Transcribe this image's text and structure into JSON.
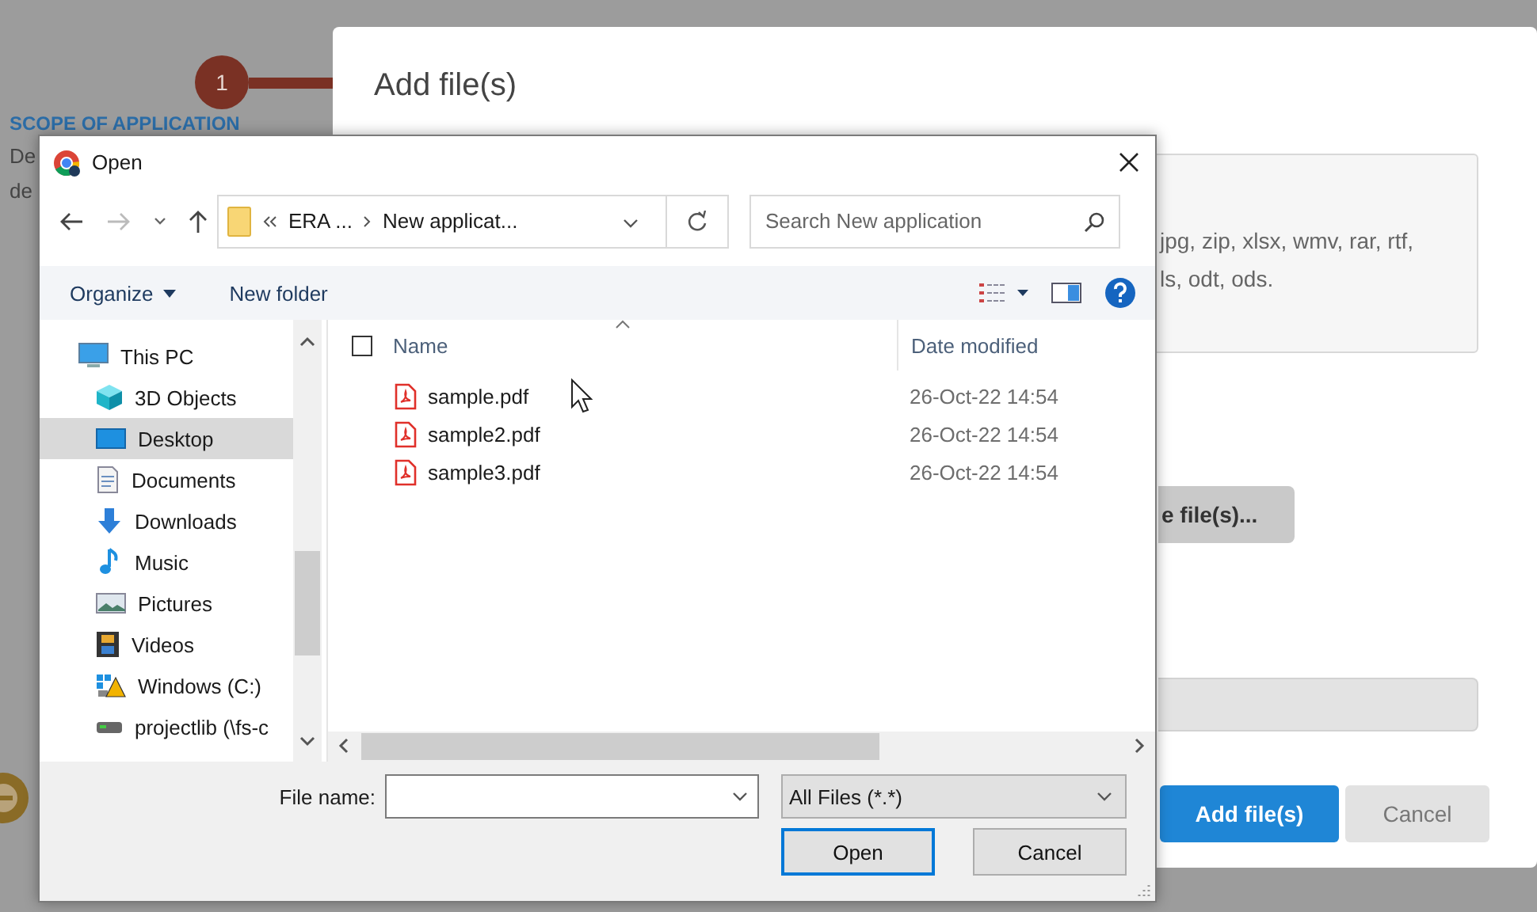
{
  "page": {
    "step_number": "1",
    "section_title": "SCOPE OF APPLICATION",
    "text_fragments": [
      "De",
      "de"
    ]
  },
  "modal": {
    "title": "Add file(s)",
    "file_types_lines": [
      "jpg, zip, xlsx, wmv, rar, rtf,",
      "ls, odt, ods."
    ],
    "browse_button": "e file(s)...",
    "buttons": [
      {
        "label": "Add file(s)",
        "kind": "primary"
      },
      {
        "label": "Cancel",
        "kind": "secondary"
      }
    ]
  },
  "dialog": {
    "title": "Open",
    "address": {
      "segments": [
        "ERA ...",
        "New applicat..."
      ]
    },
    "search": {
      "placeholder": "Search New application"
    },
    "toolbar": [
      {
        "label": "Organize",
        "menu": true
      },
      {
        "label": "New folder",
        "menu": false
      }
    ],
    "nav": [
      {
        "label": "This PC",
        "kind": "pc",
        "selected": false,
        "children": [
          {
            "label": "3D Objects",
            "kind": "cube",
            "selected": false
          },
          {
            "label": "Desktop",
            "kind": "desktop",
            "selected": true
          },
          {
            "label": "Documents",
            "kind": "documents",
            "selected": false
          },
          {
            "label": "Downloads",
            "kind": "downloads",
            "selected": false
          },
          {
            "label": "Music",
            "kind": "music",
            "selected": false
          },
          {
            "label": "Pictures",
            "kind": "pictures",
            "selected": false
          },
          {
            "label": "Videos",
            "kind": "videos",
            "selected": false
          },
          {
            "label": "Windows (C:)",
            "kind": "drive",
            "selected": false
          },
          {
            "label": "projectlib (\\fs-c",
            "kind": "network",
            "selected": false
          }
        ]
      }
    ],
    "columns": [
      "Name",
      "Date modified"
    ],
    "header_checkbox": {
      "checked": false
    },
    "files": [
      {
        "name": "sample.pdf",
        "date": "26-Oct-22 14:54",
        "selected": false
      },
      {
        "name": "sample2.pdf",
        "date": "26-Oct-22 14:54",
        "selected": false
      },
      {
        "name": "sample3.pdf",
        "date": "26-Oct-22 14:54",
        "selected": false
      }
    ],
    "file_name_label": "File name:",
    "filter": "All Files (*.*)",
    "buttons": [
      {
        "label": "Open",
        "focused": true
      },
      {
        "label": "Cancel",
        "focused": false
      }
    ]
  }
}
